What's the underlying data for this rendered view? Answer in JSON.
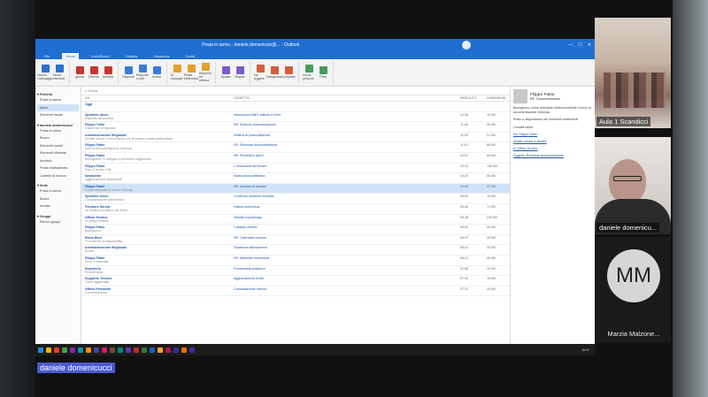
{
  "screen": {
    "title": "Posta in arrivo - daniele.domeniccio@... - Outlook",
    "tabs": [
      "File",
      "Home",
      "Invia/Ricevi",
      "Cartella",
      "Visualizza",
      "Guida"
    ],
    "active_tab": "Home",
    "ribbon": [
      {
        "group": "Nuovo",
        "buttons": [
          "Nuovo messaggio",
          "Nuovi elementi"
        ]
      },
      {
        "group": "Elimina",
        "buttons": [
          "Ignora",
          "Elimina",
          "Archivia"
        ]
      },
      {
        "group": "Rispondi",
        "buttons": [
          "Rispondi",
          "Rispondi a tutti",
          "Inoltra"
        ]
      },
      {
        "group": "Passaggi rapidi",
        "buttons": [
          "Al manager",
          "Posta elettronica",
          "Rispondi ed elimina"
        ]
      },
      {
        "group": "Sposta",
        "buttons": [
          "Sposta",
          "Regole"
        ]
      },
      {
        "group": "Tag",
        "buttons": [
          "Da leggere",
          "Categorizza",
          "Completa"
        ]
      },
      {
        "group": "Trova",
        "buttons": [
          "Cerca persone",
          "Filtra"
        ]
      }
    ],
    "search_placeholder": "Cerca",
    "columns": [
      "DA",
      "OGGETTO",
      "RICEVUTO",
      "DIMENSIONI"
    ],
    "folders": [
      {
        "group": "Preferiti",
        "items": [
          "Posta in arrivo",
          "Inbox",
          "Elementi inviati"
        ]
      },
      {
        "group": "daniele.domenicucci",
        "items": [
          "Posta in arrivo",
          "Bozze",
          "Elementi inviati",
          "Elementi eliminati",
          "Archivio",
          "Posta indesiderata",
          "Cartelle di ricerca"
        ]
      },
      {
        "group": "Sede",
        "items": [
          "Posta in arrivo",
          "Bozze",
          "Inviata"
        ]
      },
      {
        "group": "Gruppi",
        "items": [
          "Elenco gruppi"
        ]
      }
    ],
    "messages": [
      {
        "from": "Oggi",
        "preview": "",
        "subject": "",
        "date": "",
        "size": ""
      },
      {
        "from": "Sportello Unico",
        "preview": "Risposta automatica",
        "subject": "Informazioni ANIT edificio a Corte",
        "date": "12:06",
        "size": "16 KB"
      },
      {
        "from": "Filippo Tullio",
        "preview": "Grazie per la risposta",
        "subject": "RE: Sollecito documentazione",
        "date": "11:48",
        "size": "42 KB"
      },
      {
        "from": "Amministrazione Regionale",
        "preview": "Gentile utente, ti informiamo che la pratica è stata protocollata",
        "subject": "Notifica di protocollazione",
        "date": "11:30",
        "size": "21 KB"
      },
      {
        "from": "Filippo Fabio",
        "preview": "Invio la documentazione richiesta",
        "subject": "RE: Richiesta documentazione",
        "date": "11:12",
        "size": "88 KB"
      },
      {
        "from": "Filippo Fabio",
        "preview": "Buongiorno, in allegato il preventivo aggiornato",
        "subject": "RE: Preventivo lavori",
        "date": "10:57",
        "size": "64 KB"
      },
      {
        "from": "Filippo Fabio",
        "preview": "Ciao, ti inoltro il file",
        "subject": "I: Documenti da firmare",
        "date": "10:41",
        "size": "130 KB"
      },
      {
        "from": "Newsletter",
        "preview": "Aggiornamenti settimanali",
        "subject": "Novità della settimana",
        "date": "10:20",
        "size": "55 KB"
      },
      {
        "from": "Filippo Fabio",
        "preview": "Come d'accordo ti invio il riepilogo",
        "subject": "RE: Incontro di domani",
        "date": "10:05",
        "size": "37 KB"
      },
      {
        "from": "Sportello Unico",
        "preview": "Comunicazione automatica",
        "subject": "Conferma ricezione richiesta",
        "date": "09:52",
        "size": "19 KB"
      },
      {
        "from": "Fornitore Servizi",
        "preview": "Le inviamo la fattura del mese",
        "subject": "Fattura elettronica",
        "date": "09:40",
        "size": "74 KB"
      },
      {
        "from": "Ufficio Tecnico",
        "preview": "Si allega verbale",
        "subject": "Verbale sopralluogo",
        "date": "09:18",
        "size": "210 KB"
      },
      {
        "from": "Filippo Fabio",
        "preview": "Buongiorno",
        "subject": "Collaudo ottobre",
        "date": "09:02",
        "size": "45 KB"
      },
      {
        "from": "Elena Ricci",
        "preview": "Ti confermo la disponibilità",
        "subject": "RE: Calendario riunioni",
        "date": "08:47",
        "size": "28 KB"
      },
      {
        "from": "Amministrazione Regionale",
        "preview": "Avviso",
        "subject": "Scadenza adempimenti",
        "date": "08:31",
        "size": "33 KB"
      },
      {
        "from": "Filippo Fabio",
        "preview": "Ecco il materiale",
        "subject": "RE: Materiale formazione",
        "date": "08:12",
        "size": "96 KB"
      },
      {
        "from": "Segreteria",
        "preview": "Promemoria",
        "subject": "Promemoria scadenze",
        "date": "07:58",
        "size": "12 KB"
      },
      {
        "from": "Supporto Tecnico",
        "preview": "Ticket aggiornato",
        "subject": "Aggiornamento ticket",
        "date": "07:40",
        "size": "18 KB"
      },
      {
        "from": "Ufficio Personale",
        "preview": "Comunicazione",
        "subject": "Comunicazione interna",
        "date": "07:21",
        "size": "24 KB"
      }
    ],
    "reading": {
      "sender": "Filippo Fabio",
      "subject": "RE: Documentazione",
      "paragraphs": [
        "Buongiorno, come anticipato telefonicamente vi invio la documentazione richiesta.",
        "Resto a disposizione per eventuali chiarimenti.",
        "Cordiali saluti",
        "Da: Filippo Fabio",
        "Inviato: lunedì 4 ottobre",
        "A: Ufficio Tecnico",
        "Oggetto: Richiesta documentazione"
      ]
    },
    "statusbar": "Elementi: 248   Non letti: 12",
    "taskbar_time": "10:47"
  },
  "participants": [
    {
      "name": "Aula 1 Scandicci"
    },
    {
      "name": "daniele domenicu..."
    },
    {
      "name": "Marzia Malzone...",
      "initials": "MM"
    }
  ],
  "active_speaker": "daniele domenicucci"
}
